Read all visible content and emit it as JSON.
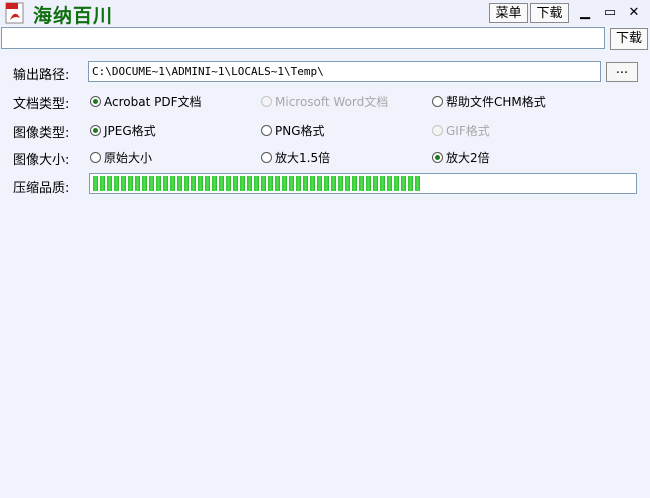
{
  "window": {
    "title": "海纳百川",
    "menu_label": "菜单",
    "download_label": "下载",
    "minimize_glyph": "▁",
    "maximize_glyph": "▭",
    "close_glyph": "✕"
  },
  "url_bar": {
    "value": "",
    "download_button": "下载"
  },
  "output_path": {
    "label": "输出路径:",
    "value": "C:\\DOCUME~1\\ADMINI~1\\LOCALS~1\\Temp\\",
    "browse_label": "..."
  },
  "doc_type": {
    "label": "文档类型:",
    "options": [
      {
        "label": "Acrobat PDF文档",
        "selected": true,
        "enabled": true
      },
      {
        "label": "Microsoft Word文档",
        "selected": false,
        "enabled": false
      },
      {
        "label": "帮助文件CHM格式",
        "selected": false,
        "enabled": true
      }
    ]
  },
  "image_type": {
    "label": "图像类型:",
    "options": [
      {
        "label": "JPEG格式",
        "selected": true,
        "enabled": true
      },
      {
        "label": "PNG格式",
        "selected": false,
        "enabled": true
      },
      {
        "label": "GIF格式",
        "selected": false,
        "enabled": false
      }
    ]
  },
  "image_size": {
    "label": "图像大小:",
    "options": [
      {
        "label": "原始大小",
        "selected": false,
        "enabled": true
      },
      {
        "label": "放大1.5倍",
        "selected": false,
        "enabled": true
      },
      {
        "label": "放大2倍",
        "selected": true,
        "enabled": true
      }
    ]
  },
  "compression": {
    "label": "压缩品质:",
    "level": 0.61
  },
  "colors": {
    "title_green": "#107010",
    "progress_green": "#32c832",
    "background": "#f0f2fc"
  },
  "icons": {
    "app": "pdf-document-icon"
  }
}
